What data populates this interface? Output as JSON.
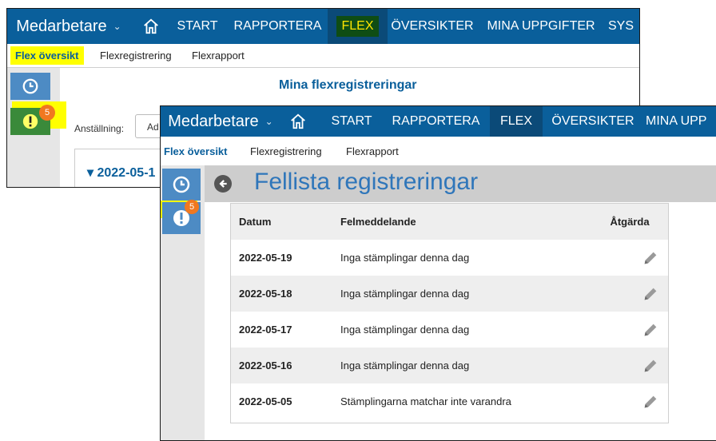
{
  "back_window": {
    "topbar": {
      "brand": "Medarbetare",
      "nav": [
        "START",
        "RAPPORTERA",
        "FLEX",
        "ÖVERSIKTER",
        "MINA UPPGIFTER",
        "SYS"
      ]
    },
    "subnav": [
      "Flex översikt",
      "Flexregistrering",
      "Flexrapport"
    ],
    "badge_count": "5",
    "title": "Mina flexregistreringar",
    "employment_label": "Anställning:",
    "employment_value": "Ad",
    "row_date": "2022-05-1"
  },
  "front_window": {
    "topbar": {
      "brand": "Medarbetare",
      "nav": [
        "START",
        "RAPPORTERA",
        "FLEX",
        "ÖVERSIKTER",
        "MINA UPP"
      ]
    },
    "subnav": [
      "Flex översikt",
      "Flexregistrering",
      "Flexrapport"
    ],
    "badge_count": "5",
    "title": "Fellista registreringar",
    "table": {
      "headers": [
        "Datum",
        "Felmeddelande",
        "Åtgärda"
      ],
      "rows": [
        {
          "date": "2022-05-19",
          "message": "Inga stämplingar denna dag"
        },
        {
          "date": "2022-05-18",
          "message": "Inga stämplingar denna dag"
        },
        {
          "date": "2022-05-17",
          "message": "Inga stämplingar denna dag"
        },
        {
          "date": "2022-05-16",
          "message": "Inga stämplingar denna dag"
        },
        {
          "date": "2022-05-05",
          "message": "Stämplingarna matchar inte varandra"
        }
      ]
    }
  },
  "icons": {
    "home": "home-icon",
    "clock": "clock-icon",
    "alert": "exclamation-icon",
    "back": "arrow-left-circle-icon",
    "edit": "pencil-icon",
    "chevron": "chevron-down-icon"
  },
  "colors": {
    "brand_blue": "#0a5f9b",
    "nav_active": "#0b4a78",
    "flex_highlight_bg": "#0f4d14",
    "flex_highlight_text": "#ffe600",
    "highlight_yellow": "#ffff00",
    "badge_orange": "#f07820",
    "sidebar_button": "#4d8bc4",
    "title_blue": "#2f76ba"
  }
}
